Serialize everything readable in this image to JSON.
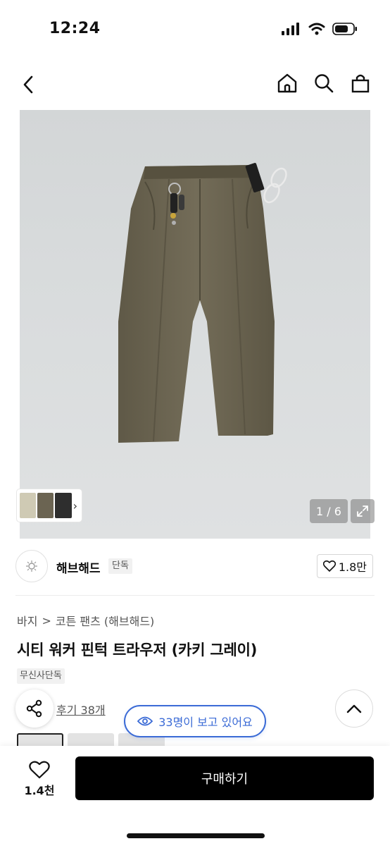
{
  "status_bar": {
    "time": "12:24"
  },
  "gallery": {
    "counter": "1 / 6"
  },
  "brand": {
    "name": "해브해드",
    "badge": "단독",
    "likes": "1.8만"
  },
  "breadcrumb": {
    "category": "바지",
    "separator": ">",
    "subcategory": "코튼 팬츠 (해브해드)"
  },
  "product": {
    "title": "시티 워커 핀턱 트라우저 (카키 그레이)",
    "tag": "무신사단독"
  },
  "reviews": {
    "link_text": "후기 38개"
  },
  "viewers": {
    "text": "33명이 보고 있어요"
  },
  "bottom_bar": {
    "wish_count": "1.4천",
    "buy_label": "구매하기"
  },
  "colors": {
    "accent_blue": "#3b6bd6",
    "pants_khaki": "#6e6754",
    "button_black": "#000000"
  }
}
